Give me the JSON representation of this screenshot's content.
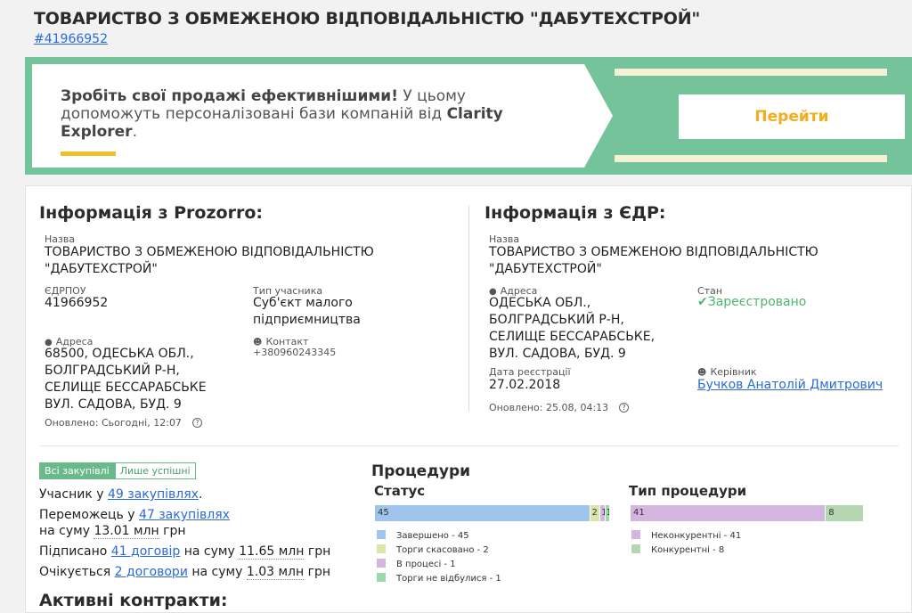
{
  "header": {
    "title": "ТОВАРИСТВО З ОБМЕЖЕНОЮ ВІДПОВІДАЛЬНІСТЮ \"ДАБУТЕХСТРОЙ\"",
    "edrpou_link": "#41966952"
  },
  "banner": {
    "bold_text": "Зробіть свої продажі ефективнішими!",
    "text": " У цьому допоможуть персоналізовані бази компаній від ",
    "brand": "Clarity Explorer",
    "end": ".",
    "button_label": "Перейти",
    "colors": {
      "green": "#75c39a",
      "yellow": "#f2bd2c"
    }
  },
  "prozorro": {
    "title": "Інформація з Prozorro:",
    "name_label": "Назва",
    "name_line1": "ТОВАРИСТВО З ОБМЕЖЕНОЮ ВІДПОВІДАЛЬНІСТЮ",
    "name_line2": "\"ДАБУТЕХСТРОЙ\"",
    "edrpou_label": "ЄДРПОУ",
    "edrpou_value": "41966952",
    "type_label": "Тип учасника",
    "type_line1": "Суб'єкт малого",
    "type_line2": "підприємництва",
    "address_label": "Адреса",
    "address_lines": [
      "68500, ОДЕСЬКА ОБЛ.,",
      "БОЛГРАДСЬКИЙ Р-Н,",
      "СЕЛИЩЕ БЕССАРАБСЬКЕ",
      "ВУЛ. САДОВА, БУД. 9"
    ],
    "contact_label": "Контакт",
    "contact_value": "+380960243345",
    "updated": "Оновлено: Сьогодні, 12:07"
  },
  "edr": {
    "title": "Інформація з ЄДР:",
    "name_label": "Назва",
    "name_line1": "ТОВАРИСТВО З ОБМЕЖЕНОЮ ВІДПОВІДАЛЬНІСТЮ",
    "name_line2": "\"ДАБУТЕХСТРОЙ\"",
    "address_label": "Адреса",
    "address_lines": [
      "ОДЕСЬКА ОБЛ.,",
      "БОЛГРАДСЬКИЙ Р-Н,",
      "СЕЛИЩЕ БЕССАРАБСЬКЕ,",
      "ВУЛ. САДОВА, БУД. 9"
    ],
    "state_label": "Стан",
    "state_value": "Зареєстровано",
    "reg_label": "Дата реєстрації",
    "reg_value": "27.02.2018",
    "head_label": "Керівник",
    "head_value": "Бучков Анатолій Дмитрович",
    "updated": "Оновлено: 25.08, 04:13"
  },
  "tabs": {
    "all": "Всі закупівлі",
    "successful": "Лише успішні"
  },
  "stats": {
    "participant_pre": "Учасник у ",
    "participant_link": "49 закупівлях",
    "participant_post": ".",
    "winner_pre": "Переможець у ",
    "winner_link": "47 закупівлях",
    "winner_sum_pre": "на суму ",
    "winner_sum": "13.01 млн",
    "winner_sum_post": " грн",
    "signed_pre": "Підписано ",
    "signed_link": "41 договір",
    "signed_mid": " на суму ",
    "signed_sum": "11.65 млн",
    "signed_post": " грн",
    "expected_pre": "Очікується ",
    "expected_link": "2 договори",
    "expected_mid": " на суму ",
    "expected_sum": "1.03 млн",
    "expected_post": " грн"
  },
  "active_contracts_title": "Активні контракти:",
  "procedures": {
    "title": "Процедури",
    "status_title": "Статус",
    "type_title": "Тип процедури"
  },
  "chart_data": [
    {
      "type": "bar",
      "title": "Статус",
      "orientation": "horizontal-stacked",
      "categories": [
        "Завершено",
        "Торги скасовано",
        "В процесі",
        "Торги не відбулися"
      ],
      "values": [
        45,
        2,
        1,
        1
      ],
      "data_labels": [
        "45",
        "2",
        "1",
        "1"
      ],
      "legend": [
        "Завершено - 45",
        "Торги скасовано - 2",
        "В процесі - 1",
        "Торги не відбулися - 1"
      ],
      "colors": [
        "#9fc5ec",
        "#d8e7a7",
        "#d3b5e0",
        "#9ad9a8"
      ]
    },
    {
      "type": "bar",
      "title": "Тип процедури",
      "orientation": "horizontal-stacked",
      "categories": [
        "Неконкурентні",
        "Конкурентні"
      ],
      "values": [
        41,
        8
      ],
      "data_labels": [
        "41",
        "8"
      ],
      "legend": [
        "Неконкурентні - 41",
        "Конкурентні - 8"
      ],
      "colors": [
        "#d3b5e0",
        "#b4d6b0"
      ]
    }
  ]
}
